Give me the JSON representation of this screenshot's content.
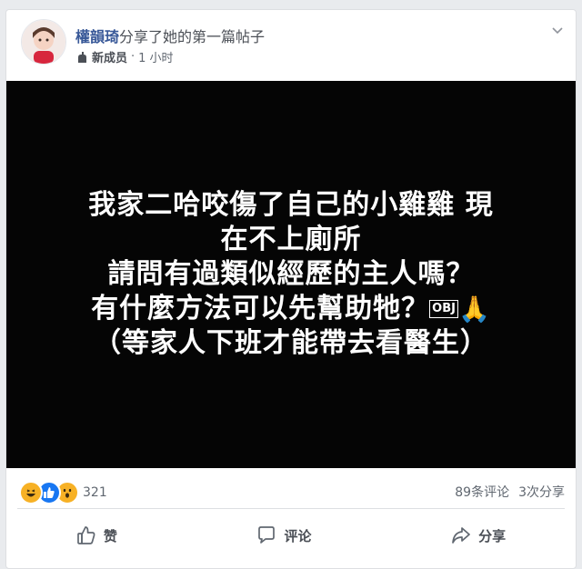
{
  "post": {
    "author": "權韻琦",
    "action": "分享了她的第一篇帖子",
    "badge": "新成员",
    "separator": "·",
    "time": "1 小时"
  },
  "media": {
    "lines": [
      "我家二哈咬傷了自己的小雞雞 現",
      "在不上廁所",
      "請問有過類似經歷的主人嗎？",
      "有什麼方法可以先幫助牠？",
      "（等家人下班才能帶去看醫生）"
    ],
    "obj_marker": "OBJ",
    "emoji": "🙏"
  },
  "stats": {
    "reaction_icons": [
      "laugh-icon",
      "like-icon",
      "wow-icon"
    ],
    "reaction_count": "321",
    "comments": "89条评论",
    "shares": "3次分享"
  },
  "actions": {
    "like": "赞",
    "comment": "评论",
    "share": "分享"
  },
  "colors": {
    "name": "#385898",
    "like_blue": "#1877f2",
    "reaction_yellow": "#f7b125",
    "media_bg": "#050505"
  }
}
